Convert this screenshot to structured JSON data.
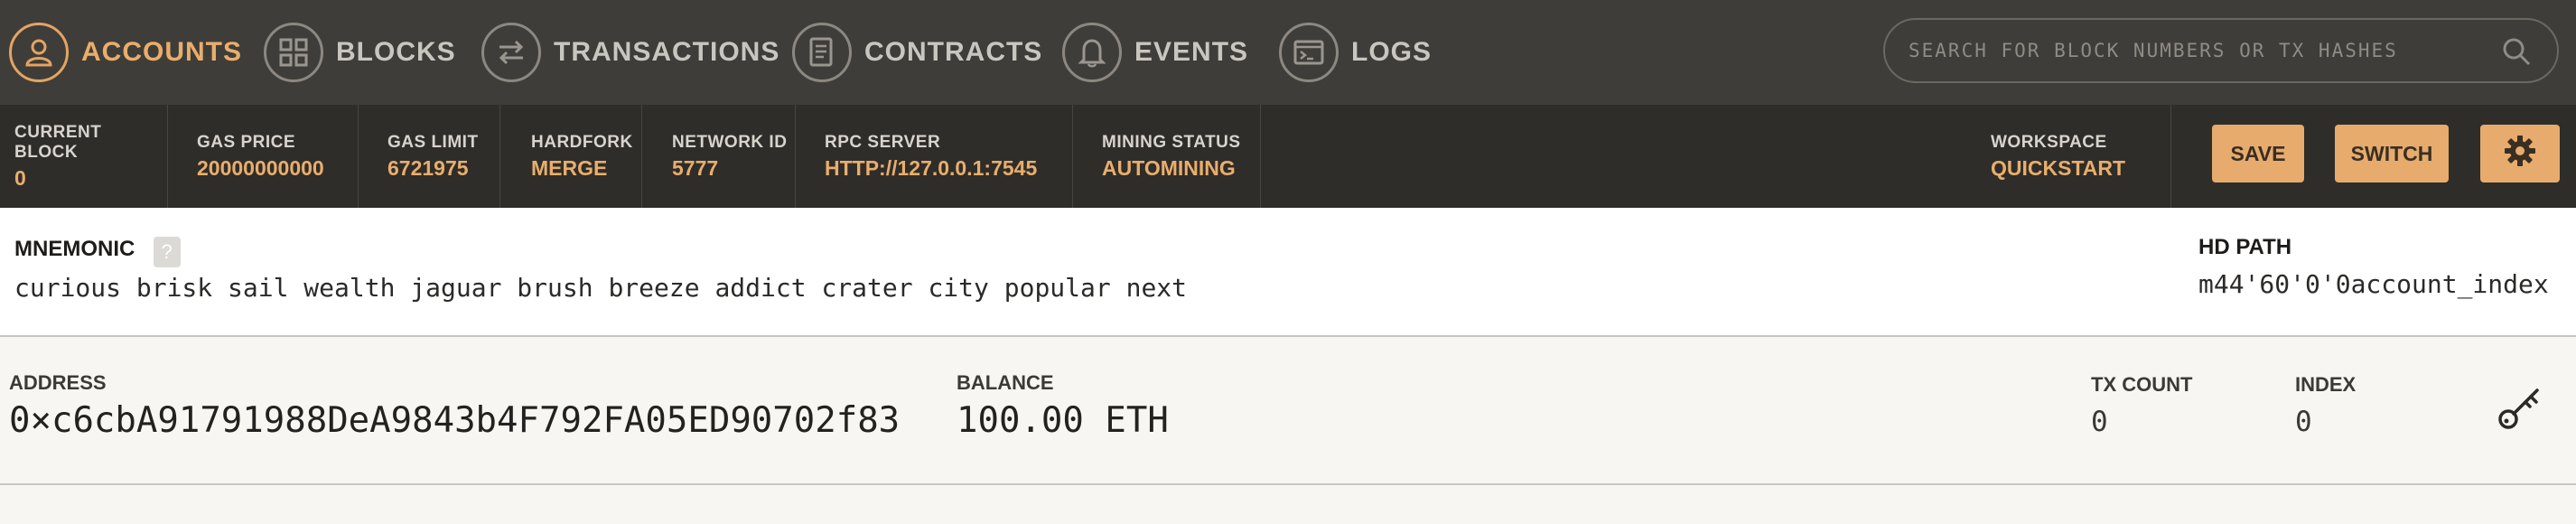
{
  "nav": {
    "accounts": "ACCOUNTS",
    "blocks": "BLOCKS",
    "transactions": "TRANSACTIONS",
    "contracts": "CONTRACTS",
    "events": "EVENTS",
    "logs": "LOGS",
    "search_placeholder": "SEARCH FOR BLOCK NUMBERS OR TX HASHES",
    "active_color": "#e9ae6c"
  },
  "status": {
    "current_block": {
      "label": "CURRENT BLOCK",
      "value": "0"
    },
    "gas_price": {
      "label": "GAS PRICE",
      "value": "20000000000"
    },
    "gas_limit": {
      "label": "GAS LIMIT",
      "value": "6721975"
    },
    "hardfork": {
      "label": "HARDFORK",
      "value": "MERGE"
    },
    "network_id": {
      "label": "NETWORK ID",
      "value": "5777"
    },
    "rpc_server": {
      "label": "RPC SERVER",
      "value": "HTTP://127.0.0.1:7545"
    },
    "mining_status": {
      "label": "MINING STATUS",
      "value": "AUTOMINING"
    },
    "workspace": {
      "label": "WORKSPACE",
      "value": "QUICKSTART"
    },
    "save_label": "SAVE",
    "switch_label": "SWITCH"
  },
  "mnemonic": {
    "label": "MNEMONIC",
    "help": "?",
    "words": "curious brisk sail wealth jaguar brush breeze addict crater city popular next",
    "hd_path_label": "HD PATH",
    "hd_path": "m44'60'0'0account_index"
  },
  "account": {
    "address_label": "ADDRESS",
    "address": "0×c6cbA91791988DeA9843b4F792FA05ED90702f83",
    "balance_label": "BALANCE",
    "balance": "100.00 ETH",
    "tx_count_label": "TX COUNT",
    "tx_count": "0",
    "index_label": "INDEX",
    "index": "0"
  }
}
